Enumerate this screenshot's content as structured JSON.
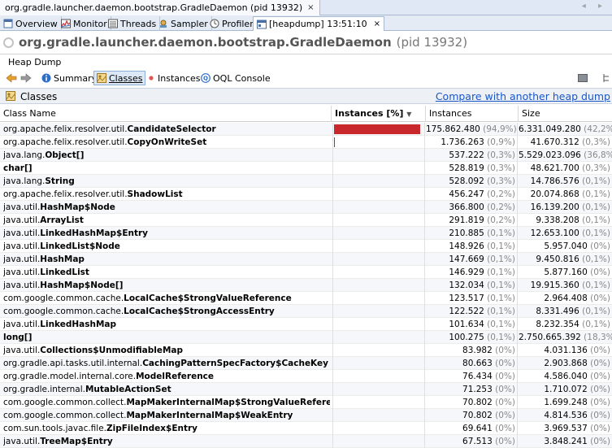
{
  "window_tab": {
    "title": "org.gradle.launcher.daemon.bootstrap.GradleDaemon (pid 13932)",
    "close": "×"
  },
  "window_nav": "◂ ▸",
  "subtabs": [
    {
      "label": "Overview",
      "icon": "overview-icon"
    },
    {
      "label": "Monitor",
      "icon": "monitor-icon"
    },
    {
      "label": "Threads",
      "icon": "threads-icon"
    },
    {
      "label": "Sampler",
      "icon": "sampler-icon"
    },
    {
      "label": "Profiler",
      "icon": "profiler-icon"
    },
    {
      "label": "[heapdump] 13:51:10",
      "icon": "heapdump-icon",
      "close": "×",
      "active": true
    }
  ],
  "app_title": {
    "name": "org.gradle.launcher.daemon.bootstrap.GradleDaemon",
    "pid": "(pid 13932)"
  },
  "heap_dump_label": "Heap Dump",
  "toolbar": {
    "summary": "Summary",
    "classes": "Classes",
    "instances": "Instances",
    "oql": "OQL Console"
  },
  "classes_header": {
    "label": "Classes",
    "compare_link": "Compare with another heap dump"
  },
  "table": {
    "columns": {
      "name": "Class Name",
      "bar": "Instances [%]",
      "sort_indicator": "▼",
      "instances": "Instances",
      "size": "Size"
    },
    "rows": [
      {
        "pkg": "org.apache.felix.resolver.util.",
        "cls": "CandidateSelector",
        "instances": "175.862.480",
        "ipct": "(94,9%)",
        "size": "6.331.049.280",
        "spct": "(42,2%)",
        "share": 0.949
      },
      {
        "pkg": "org.apache.felix.resolver.util.",
        "cls": "CopyOnWriteSet",
        "instances": "1.736.263",
        "ipct": "(0,9%)",
        "size": "41.670.312",
        "spct": "(0,3%)",
        "share": 0.009
      },
      {
        "pkg": "java.lang.",
        "cls": "Object[]",
        "instances": "537.222",
        "ipct": "(0,3%)",
        "size": "5.529.023.096",
        "spct": "(36,8%)",
        "share": 0.003
      },
      {
        "pkg": "",
        "cls": "char[]",
        "instances": "528.819",
        "ipct": "(0,3%)",
        "size": "48.621.700",
        "spct": "(0,3%)",
        "share": 0.003
      },
      {
        "pkg": "java.lang.",
        "cls": "String",
        "instances": "528.092",
        "ipct": "(0,3%)",
        "size": "14.786.576",
        "spct": "(0,1%)",
        "share": 0.003
      },
      {
        "pkg": "org.apache.felix.resolver.util.",
        "cls": "ShadowList",
        "instances": "456.247",
        "ipct": "(0,2%)",
        "size": "20.074.868",
        "spct": "(0,1%)",
        "share": 0.002
      },
      {
        "pkg": "java.util.",
        "cls": "HashMap$Node",
        "instances": "366.800",
        "ipct": "(0,2%)",
        "size": "16.139.200",
        "spct": "(0,1%)",
        "share": 0.002
      },
      {
        "pkg": "java.util.",
        "cls": "ArrayList",
        "instances": "291.819",
        "ipct": "(0,2%)",
        "size": "9.338.208",
        "spct": "(0,1%)",
        "share": 0.002
      },
      {
        "pkg": "java.util.",
        "cls": "LinkedHashMap$Entry",
        "instances": "210.885",
        "ipct": "(0,1%)",
        "size": "12.653.100",
        "spct": "(0,1%)",
        "share": 0.001
      },
      {
        "pkg": "java.util.",
        "cls": "LinkedList$Node",
        "instances": "148.926",
        "ipct": "(0,1%)",
        "size": "5.957.040",
        "spct": "(0%)",
        "share": 0.001
      },
      {
        "pkg": "java.util.",
        "cls": "HashMap",
        "instances": "147.669",
        "ipct": "(0,1%)",
        "size": "9.450.816",
        "spct": "(0,1%)",
        "share": 0.001
      },
      {
        "pkg": "java.util.",
        "cls": "LinkedList",
        "instances": "146.929",
        "ipct": "(0,1%)",
        "size": "5.877.160",
        "spct": "(0%)",
        "share": 0.001
      },
      {
        "pkg": "java.util.",
        "cls": "HashMap$Node[]",
        "instances": "132.034",
        "ipct": "(0,1%)",
        "size": "19.915.360",
        "spct": "(0,1%)",
        "share": 0.001
      },
      {
        "pkg": "com.google.common.cache.",
        "cls": "LocalCache$StrongValueReference",
        "instances": "123.517",
        "ipct": "(0,1%)",
        "size": "2.964.408",
        "spct": "(0%)",
        "share": 0.001
      },
      {
        "pkg": "com.google.common.cache.",
        "cls": "LocalCache$StrongAccessEntry",
        "instances": "122.522",
        "ipct": "(0,1%)",
        "size": "8.331.496",
        "spct": "(0,1%)",
        "share": 0.001
      },
      {
        "pkg": "java.util.",
        "cls": "LinkedHashMap",
        "instances": "101.634",
        "ipct": "(0,1%)",
        "size": "8.232.354",
        "spct": "(0,1%)",
        "share": 0.001
      },
      {
        "pkg": "",
        "cls": "long[]",
        "instances": "100.275",
        "ipct": "(0,1%)",
        "size": "2.750.665.392",
        "spct": "(18,3%)",
        "share": 0.001
      },
      {
        "pkg": "java.util.",
        "cls": "Collections$UnmodifiableMap",
        "instances": "83.982",
        "ipct": "(0%)",
        "size": "4.031.136",
        "spct": "(0%)",
        "share": 0
      },
      {
        "pkg": "org.gradle.api.tasks.util.internal.",
        "cls": "CachingPatternSpecFactory$CacheKey",
        "instances": "80.663",
        "ipct": "(0%)",
        "size": "2.903.868",
        "spct": "(0%)",
        "share": 0
      },
      {
        "pkg": "org.gradle.model.internal.core.",
        "cls": "ModelReference",
        "instances": "76.434",
        "ipct": "(0%)",
        "size": "4.586.040",
        "spct": "(0%)",
        "share": 0
      },
      {
        "pkg": "org.gradle.internal.",
        "cls": "MutableActionSet",
        "instances": "71.253",
        "ipct": "(0%)",
        "size": "1.710.072",
        "spct": "(0%)",
        "share": 0
      },
      {
        "pkg": "com.google.common.collect.",
        "cls": "MapMakerInternalMap$StrongValueReference",
        "instances": "70.802",
        "ipct": "(0%)",
        "size": "1.699.248",
        "spct": "(0%)",
        "share": 0
      },
      {
        "pkg": "com.google.common.collect.",
        "cls": "MapMakerInternalMap$WeakEntry",
        "instances": "70.802",
        "ipct": "(0%)",
        "size": "4.814.536",
        "spct": "(0%)",
        "share": 0
      },
      {
        "pkg": "com.sun.tools.javac.file.",
        "cls": "ZipFileIndex$Entry",
        "instances": "69.641",
        "ipct": "(0%)",
        "size": "3.969.537",
        "spct": "(0%)",
        "share": 0
      },
      {
        "pkg": "java.util.",
        "cls": "TreeMap$Entry",
        "instances": "67.513",
        "ipct": "(0%)",
        "size": "3.848.241",
        "spct": "(0%)",
        "share": 0
      }
    ]
  },
  "colors": {
    "bar": "#c8282b",
    "link": "#1a56c8"
  }
}
